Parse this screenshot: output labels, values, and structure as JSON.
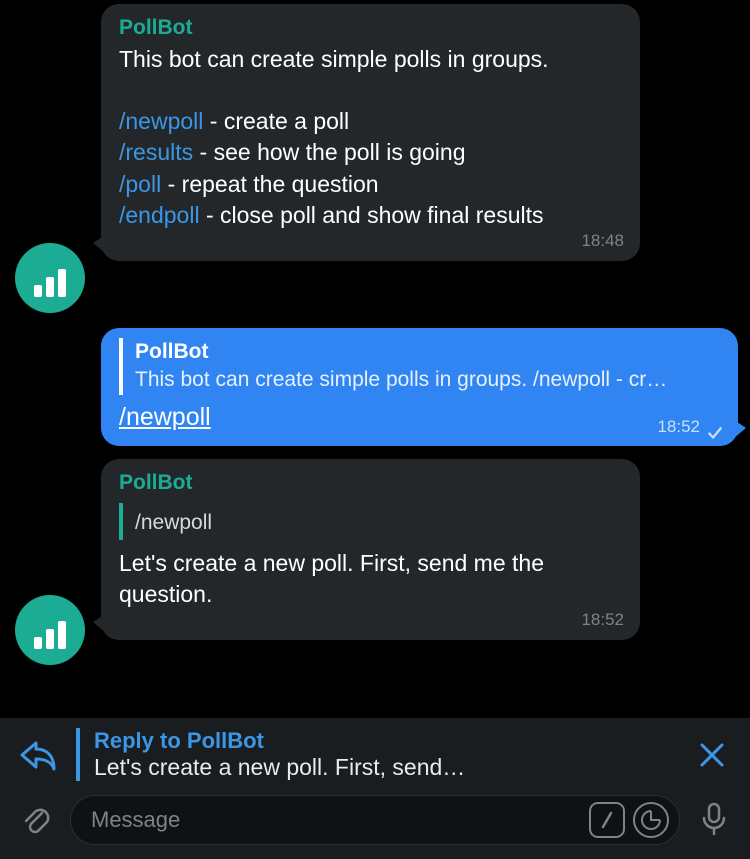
{
  "bot": {
    "name": "PollBot"
  },
  "avatar_icon": "bar-chart-icon",
  "messages": {
    "m1": {
      "sender": "PollBot",
      "intro": "This bot can create simple polls in groups.",
      "commands": [
        {
          "cmd": "/newpoll",
          "desc": "create a poll"
        },
        {
          "cmd": "/results",
          "desc": "see how the poll is going"
        },
        {
          "cmd": "/poll",
          "desc": "repeat the question"
        },
        {
          "cmd": "/endpoll",
          "desc": "close poll and show final results"
        }
      ],
      "time": "18:48"
    },
    "m2": {
      "reply_title": "PollBot",
      "reply_snippet": "This bot can create simple polls in groups. /newpoll - cr…",
      "text": "/newpoll",
      "time": "18:52",
      "status": "sent"
    },
    "m3": {
      "sender": "PollBot",
      "reply_snippet": "/newpoll",
      "text": "Let's create a new poll. First, send me the question.",
      "time": "18:52"
    }
  },
  "compose": {
    "reply_title": "Reply to PollBot",
    "reply_snippet": "Let's create a new poll. First, send…",
    "placeholder": "Message"
  },
  "icons": {
    "reply_arrow": "reply-arrow-icon",
    "close": "close-icon",
    "attach": "paperclip-icon",
    "slash": "slash-command-icon",
    "sticker": "sticker-icon",
    "mic": "microphone-icon"
  }
}
